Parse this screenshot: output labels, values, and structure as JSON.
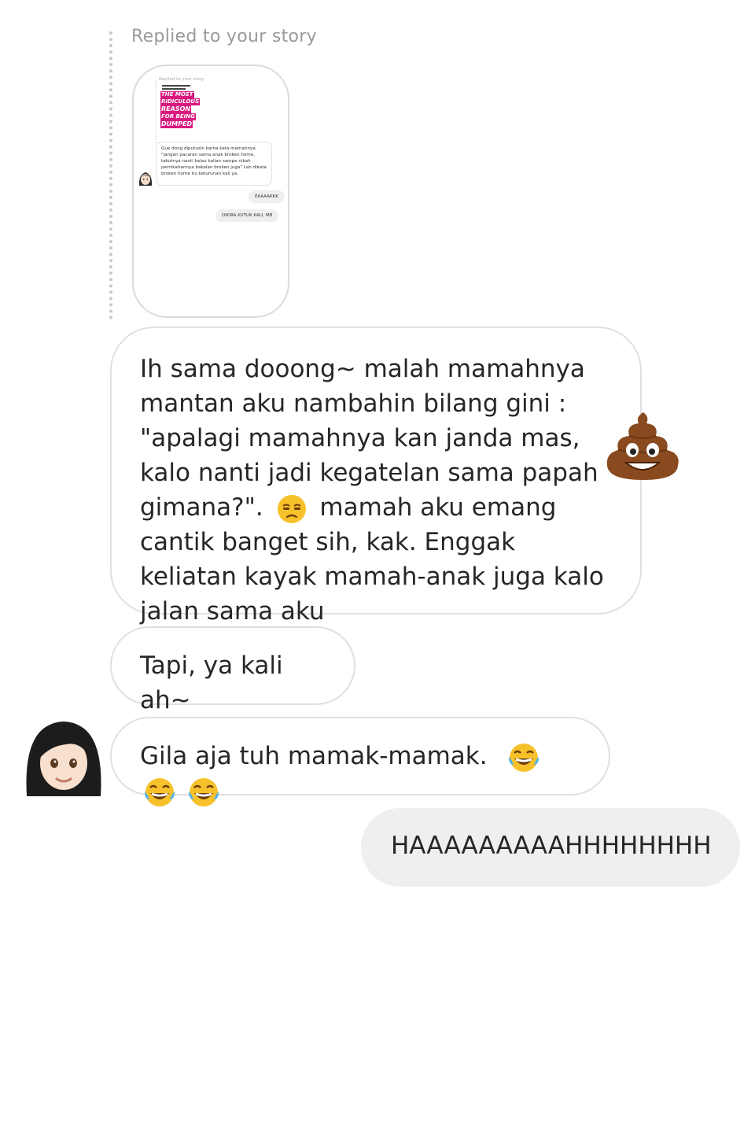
{
  "story_reply": {
    "label": "Replied to your story",
    "thumbnail": {
      "label": "Replied to your story",
      "poster_lines": [
        "THE MOST",
        "RIDICULOUS",
        "REASON",
        "FOR BEING",
        "DUMPED"
      ],
      "message": "Gue dong diputusin karna kata mamahnya \"jangan pacaran sama anak broken home, takutnya nanti kalau kalian sampe nikah pernikahannya bakalan broken juga\" Lah dikata broken home itu keturunan kali ya.",
      "reply_1": "EAAAAKKK",
      "reply_2": "DIKIRA KUTUK KALI, MB"
    }
  },
  "messages": [
    {
      "text": "Ih sama dooong~ malah mamahnya mantan aku nambahin bilang gini : \"apalagi mamahnya kan janda mas, kalo nanti jadi kegatelan sama papah gimana?\".",
      "text_after_emoji": "mamah aku emang cantik banget sih, kak. Enggak keliatan kayak mamah-anak juga kalo jalan sama aku",
      "inline_emoji": "unamused-face",
      "reaction": "pile-of-poo"
    },
    {
      "text": "Tapi, ya kali ah~"
    },
    {
      "text": "Gila aja tuh mamak-mamak.",
      "emojis": [
        "face-with-tears-of-joy",
        "face-with-tears-of-joy",
        "face-with-tears-of-joy"
      ]
    },
    {
      "text": "HAAAAAAAAAHHHHHHHH",
      "outgoing": true
    }
  ],
  "sender_avatar": "woman-emoji-avatar",
  "colors": {
    "outgoing_bubble": "#efefef",
    "border": "#e0e0e0",
    "poster": "#d8197f"
  }
}
